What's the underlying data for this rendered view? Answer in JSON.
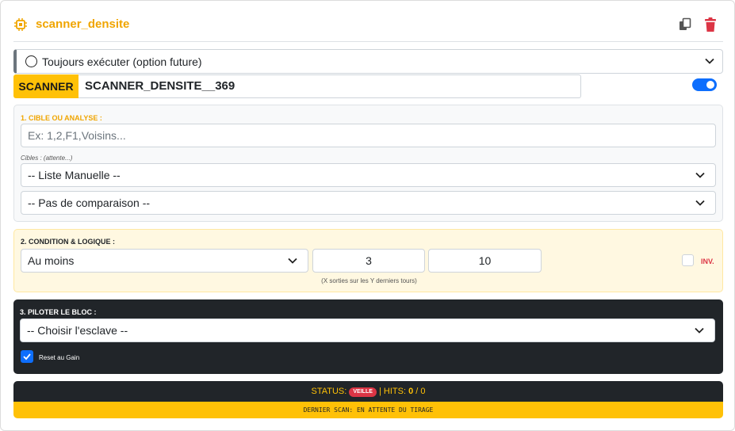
{
  "header": {
    "title": "scanner_densite",
    "chip_icon": "cpu-chip-icon",
    "copy_icon": "copy-icon",
    "delete_icon": "trash-icon",
    "accent": "#f0a500",
    "danger": "#dc3545"
  },
  "always_run": {
    "label": "Toujours exécuter (option future)"
  },
  "scanner": {
    "tag": "SCANNER",
    "name": "SCANNER_DENSITE__369",
    "enabled": true
  },
  "section1": {
    "title": "1. CIBLE OU ANALYSE :",
    "targets_placeholder": "Ex: 1,2,F1,Voisins...",
    "targets_hint": "Cibles : (attente...)",
    "list_select": "-- Liste Manuelle --",
    "compare_select": "-- Pas de comparaison --"
  },
  "section2": {
    "title": "2. CONDITION & LOGIQUE :",
    "mode_select": "Au moins",
    "x_value": "3",
    "y_value": "10",
    "inv_label": "INV.",
    "hint": "(X sorties sur les Y derniers tours)"
  },
  "section3": {
    "title": "3. PILOTER LE BLOC :",
    "slave_select": "-- Choisir l'esclave --",
    "reset_label": "Reset au Gain",
    "reset_checked": true
  },
  "status": {
    "label": "STATUS:",
    "badge": "VEILLE",
    "sep": "| HITS:",
    "hits": "0",
    "total": "/ 0",
    "last_scan": "DERNIER SCAN: EN ATTENTE DU TIRAGE"
  }
}
